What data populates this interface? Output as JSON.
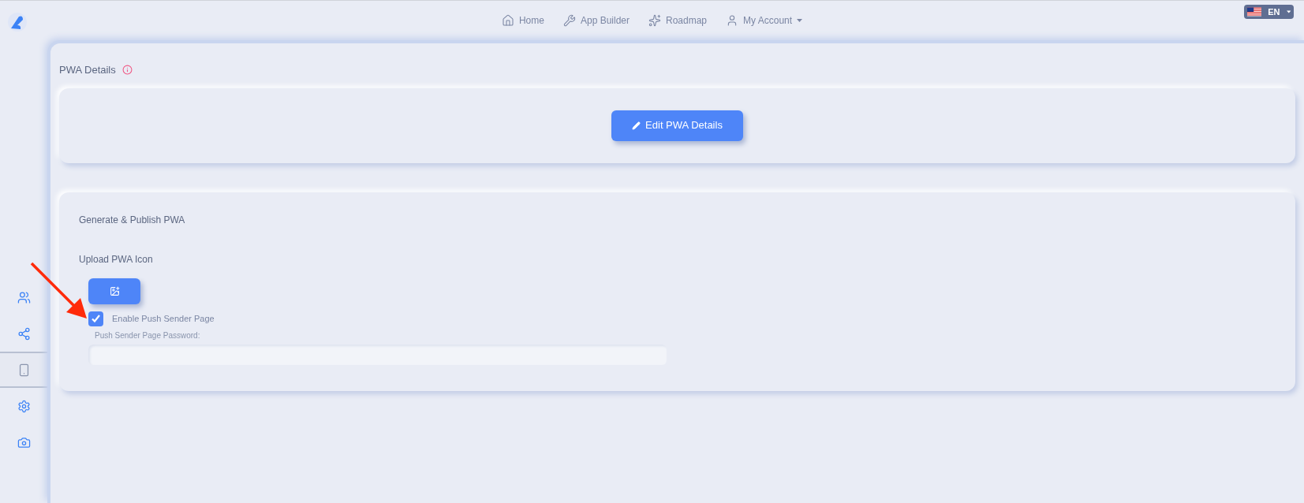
{
  "nav": [
    {
      "kind": "home",
      "label": "Home"
    },
    {
      "kind": "builder",
      "label": "App Builder"
    },
    {
      "kind": "roadmap",
      "label": "Roadmap"
    },
    {
      "kind": "account",
      "label": "My Account"
    }
  ],
  "language": {
    "label": "EN"
  },
  "sidebar": {
    "items": [
      {
        "kind": "users",
        "selected": false
      },
      {
        "kind": "share",
        "selected": false
      },
      {
        "kind": "phone",
        "selected": true
      },
      {
        "kind": "settings",
        "selected": false
      },
      {
        "kind": "camera",
        "selected": false
      }
    ]
  },
  "section_title": "PWA Details",
  "edit_button": "Edit PWA Details",
  "publish": {
    "title": "Generate & Publish PWA",
    "upload_label": "Upload PWA Icon",
    "push_checkbox": {
      "label": "Enable Push Sender Page",
      "checked": true
    },
    "password_label": "Push Sender Page Password:"
  }
}
